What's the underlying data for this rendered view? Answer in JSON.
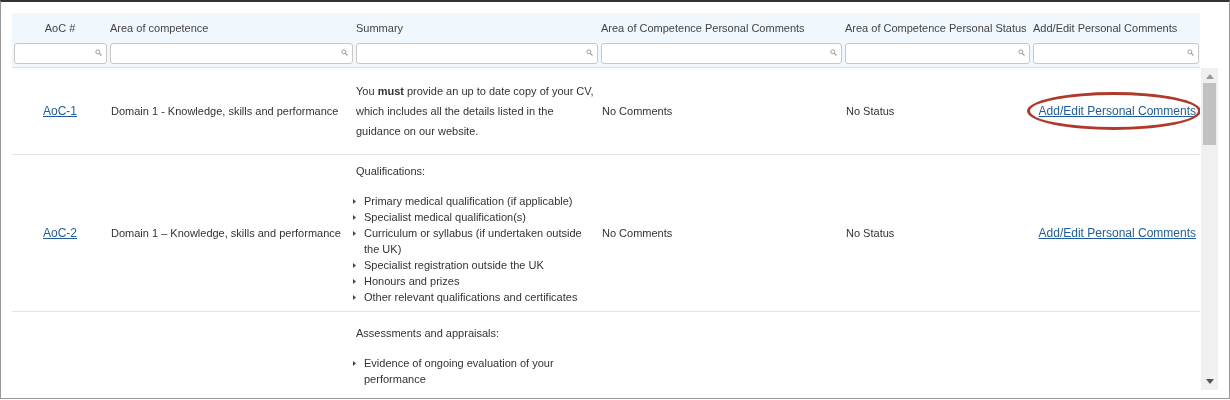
{
  "table": {
    "columns": [
      "AoC #",
      "Area of competence",
      "Summary",
      "Area of Competence Personal Comments",
      "Area of Competence Personal Status",
      "Add/Edit Personal Comments"
    ],
    "rows": [
      {
        "id": "AoC-1",
        "area": "Domain 1 - Knowledge, skills and performance",
        "summary": {
          "intro": "You **must** provide an up to date copy of your CV, which includes all the details listed in the guidance on our website."
        },
        "comments": "No Comments",
        "status": "No Status",
        "action": "Add/Edit Personal Comments",
        "annotated": true
      },
      {
        "id": "AoC-2",
        "area": "Domain 1 – Knowledge, skills and performance",
        "summary": {
          "intro": "Qualifications:",
          "bullets": [
            "Primary medical qualification (if applicable)",
            "Specialist medical qualification(s)",
            "Curriculum or syllabus (if undertaken outside the UK)",
            "Specialist registration outside the UK",
            "Honours and prizes",
            "Other relevant qualifications and certificates"
          ]
        },
        "comments": "No Comments",
        "status": "No Status",
        "action": "Add/Edit Personal Comments",
        "annotated": false
      },
      {
        "summary": {
          "intro": "Assessments and appraisals:",
          "bullets": [
            "Evidence of ongoing evaluation of your performance"
          ]
        }
      }
    ]
  }
}
